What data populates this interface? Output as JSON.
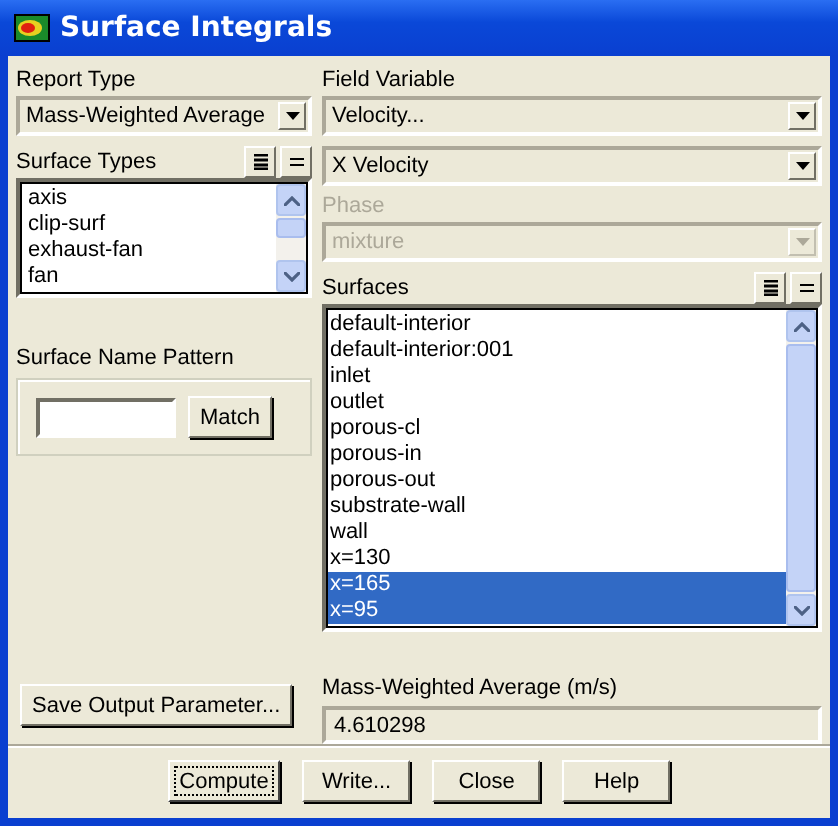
{
  "window": {
    "title": "Surface Integrals"
  },
  "report_type": {
    "label": "Report Type",
    "value": "Mass-Weighted Average"
  },
  "surface_types": {
    "label": "Surface Types",
    "items": [
      {
        "label": "axis",
        "selected": false
      },
      {
        "label": "clip-surf",
        "selected": false
      },
      {
        "label": "exhaust-fan",
        "selected": false
      },
      {
        "label": "fan",
        "selected": false
      }
    ]
  },
  "surface_name_pattern": {
    "label": "Surface Name Pattern",
    "match_button": "Match"
  },
  "save_output_button": "Save Output Parameter...",
  "field_variable": {
    "label": "Field Variable",
    "category": "Velocity...",
    "value": "X Velocity"
  },
  "phase": {
    "label": "Phase",
    "value": "mixture",
    "disabled": true
  },
  "surfaces": {
    "label": "Surfaces",
    "items": [
      {
        "label": "default-interior",
        "selected": false
      },
      {
        "label": "default-interior:001",
        "selected": false
      },
      {
        "label": "inlet",
        "selected": false
      },
      {
        "label": "outlet",
        "selected": false
      },
      {
        "label": "porous-cl",
        "selected": false
      },
      {
        "label": "porous-in",
        "selected": false
      },
      {
        "label": "porous-out",
        "selected": false
      },
      {
        "label": "substrate-wall",
        "selected": false
      },
      {
        "label": "wall",
        "selected": false
      },
      {
        "label": "x=130",
        "selected": false
      },
      {
        "label": "x=165",
        "selected": true
      },
      {
        "label": "x=95",
        "selected": true
      }
    ]
  },
  "result": {
    "label": "Mass-Weighted Average (m/s)",
    "value": "4.610298"
  },
  "buttons": [
    {
      "label": "Compute",
      "focused": true
    },
    {
      "label": "Write...",
      "focused": false
    },
    {
      "label": "Close",
      "focused": false
    },
    {
      "label": "Help",
      "focused": false
    }
  ]
}
